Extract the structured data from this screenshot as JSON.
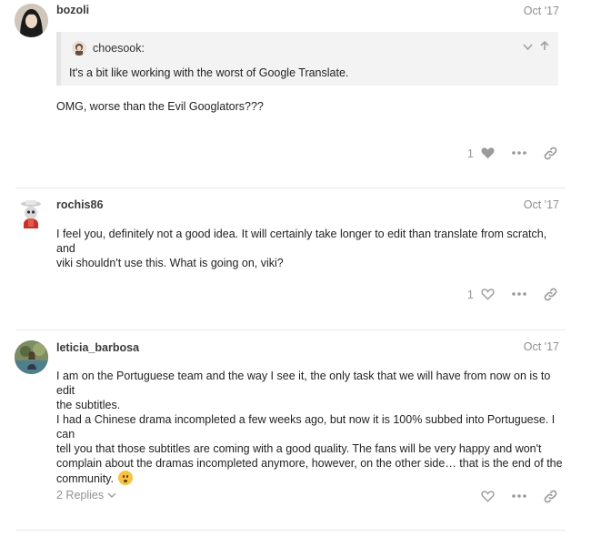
{
  "posts": [
    {
      "username": "bozoli",
      "date": "Oct '17",
      "quote": {
        "username": "choesook:",
        "text": "It's a bit like working with the worst of Google Translate."
      },
      "body": "OMG, worse than the Evil Googlators???",
      "like_count": "1",
      "liked": true
    },
    {
      "username": "rochis86",
      "date": "Oct '17",
      "body_lines": [
        "I feel you, definitely not a good idea. It will certainly take longer to edit than translate from scratch, and",
        "viki shouldn't use this. What is going on, viki?"
      ],
      "like_count": "1",
      "liked": false
    },
    {
      "username": "leticia_barbosa",
      "date": "Oct '17",
      "body_lines": [
        "I am on the Portuguese team and the way I see it, the only task that we will have from now on is to edit",
        "the subtitles.",
        "I had a Chinese drama incompleted a few weeks ago, but now it is 100% subbed into Portuguese. I can",
        "tell you that those subtitles are coming with a good quality. The fans will be very happy and won't",
        "complain about the dramas incompleted anymore, however, on the other side… that is the end of the",
        "community."
      ],
      "emoji": "frowning-face-emoji",
      "replies_label": "2 Replies",
      "liked": false
    }
  ],
  "icons": {
    "heart": "heart-icon",
    "more": "ellipsis-icon",
    "link": "link-icon",
    "chevron_down": "chevron-down-icon",
    "arrow_up": "arrow-up-icon"
  },
  "colors": {
    "muted": "#9a9a9a",
    "divider": "#e9e9e9",
    "quote_bg": "#f3f3f3"
  }
}
